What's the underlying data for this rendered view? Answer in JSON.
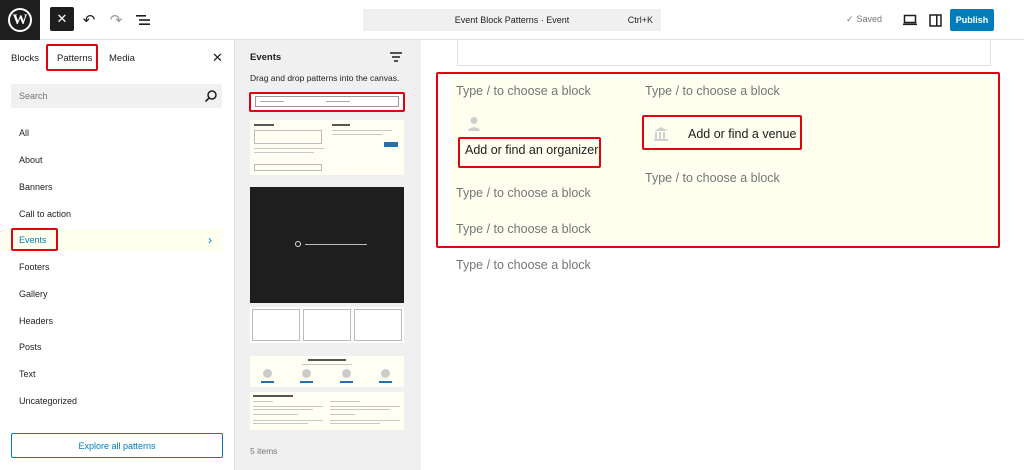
{
  "topbar": {
    "logo_letter": "W",
    "close_glyph": "✕",
    "undo_glyph": "↶",
    "redo_glyph": "↷",
    "doc_title": "Event Block Patterns · Event",
    "shortcut": "Ctrl+K",
    "saved_label": "Saved",
    "publish_label": "Publish"
  },
  "sidebar": {
    "tabs": [
      "Blocks",
      "Patterns",
      "Media"
    ],
    "active_tab": "Patterns",
    "search_placeholder": "Search",
    "categories": [
      "All",
      "About",
      "Banners",
      "Call to action",
      "Events",
      "Footers",
      "Gallery",
      "Headers",
      "Posts",
      "Text",
      "Uncategorized"
    ],
    "active_category": "Events",
    "explore_label": "Explore all patterns"
  },
  "patterns_panel": {
    "title": "Events",
    "subtitle": "Drag and drop patterns into the canvas.",
    "items_count": "5 items"
  },
  "canvas": {
    "placeholder": "Type / to choose a block",
    "organizer_label": "Add or find an organizer",
    "venue_label": "Add or find a venue"
  },
  "colors": {
    "accent": "#007cba",
    "highlight": "#e3000f",
    "block_bg": "#fffff0"
  }
}
